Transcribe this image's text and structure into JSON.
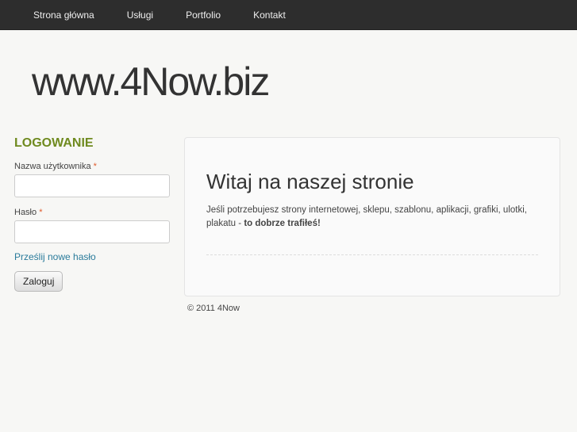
{
  "nav": {
    "items": [
      "Strona główna",
      "Usługi",
      "Portfolio",
      "Kontakt"
    ]
  },
  "header": {
    "site_title": "www.4Now.biz"
  },
  "login": {
    "title": "LOGOWANIE",
    "username_label": "Nazwa użytkownika",
    "password_label": "Hasło",
    "required_mark": "*",
    "username_value": "",
    "password_value": "",
    "reset_link": "Prześlij nowe hasło",
    "submit": "Zaloguj"
  },
  "content": {
    "title": "Witaj na naszej stronie",
    "text": "Jeśli potrzebujesz strony internetowej, sklepu, szablonu, aplikacji, grafiki, ulotki, plakatu - ",
    "text_bold": "to dobrze trafiłeś!"
  },
  "footer": {
    "copyright": "© 2011 4Now"
  }
}
